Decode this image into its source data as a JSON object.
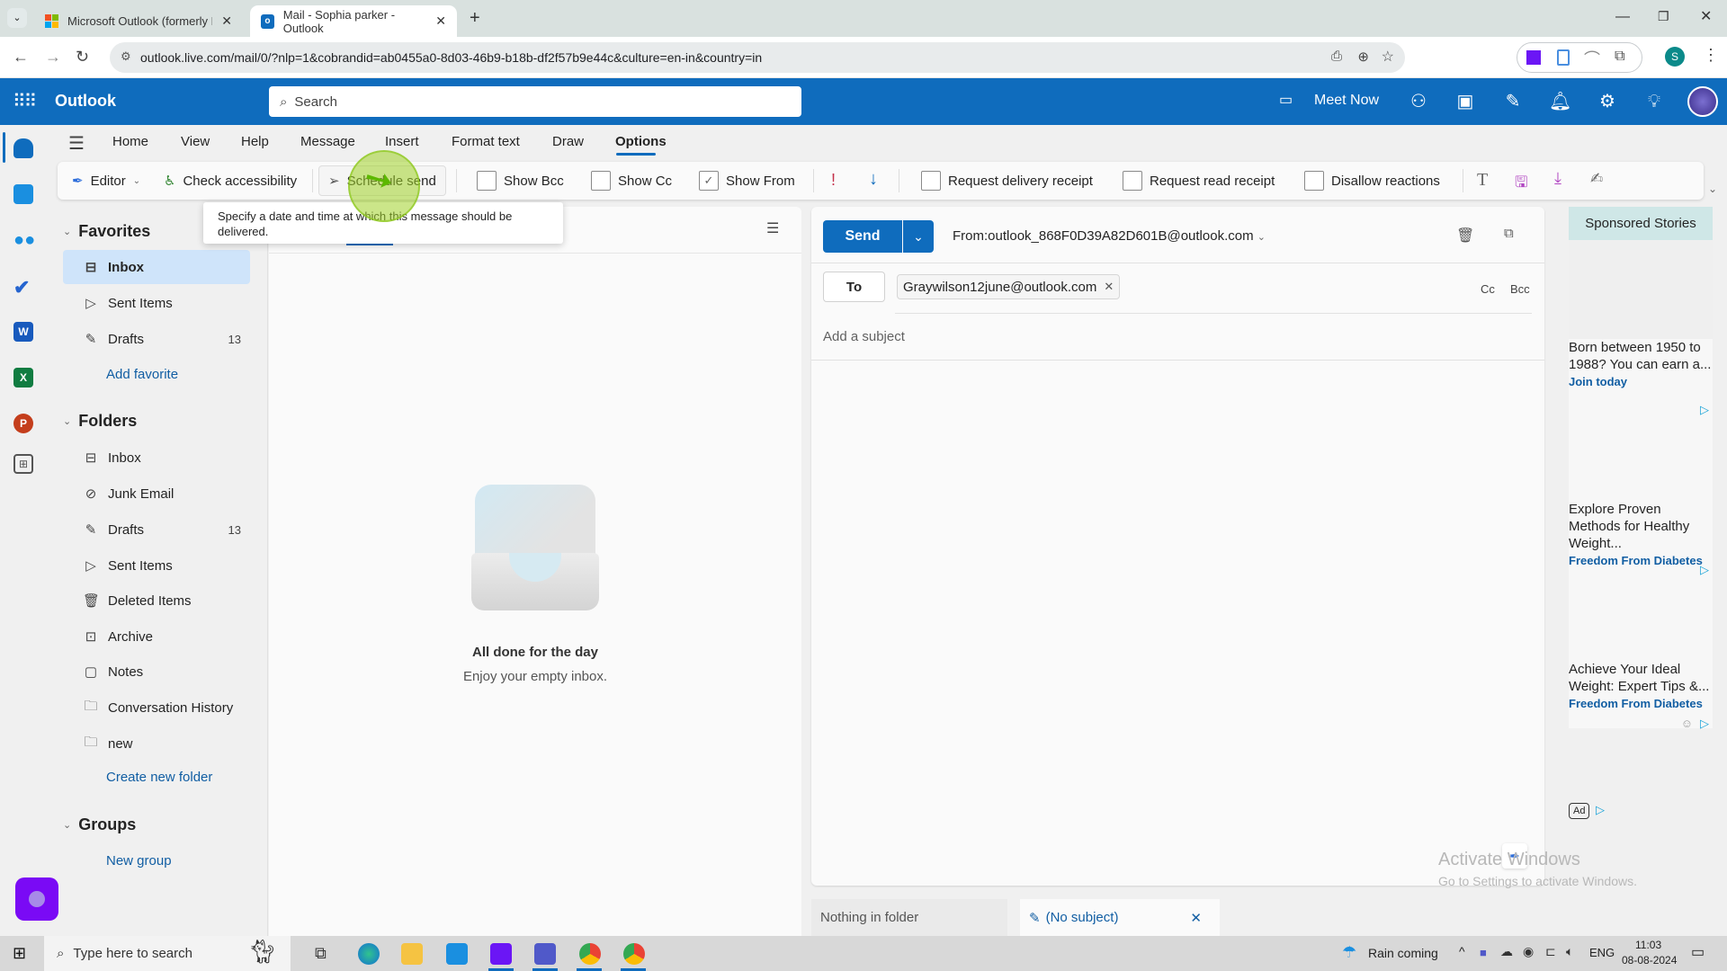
{
  "browser": {
    "tabs": [
      {
        "title": "Microsoft Outlook (formerly Ho",
        "active": false
      },
      {
        "title": "Mail - Sophia parker - Outlook",
        "active": true
      }
    ],
    "url": "outlook.live.com/mail/0/?nlp=1&cobrandid=ab0455a0-8d03-46b9-b18b-df2f57b9e44c&culture=en-in&country=in",
    "profile_initial": "S"
  },
  "app": {
    "name": "Outlook",
    "search_placeholder": "Search",
    "meet_now": "Meet Now"
  },
  "ribbon_tabs": [
    "Home",
    "View",
    "Help",
    "Message",
    "Insert",
    "Format text",
    "Draw",
    "Options"
  ],
  "active_ribbon_tab": "Options",
  "ribbon": {
    "editor": "Editor",
    "check_accessibility": "Check accessibility",
    "schedule_send": "Schedule send",
    "show_bcc": {
      "label": "Show Bcc",
      "checked": false
    },
    "show_cc": {
      "label": "Show Cc",
      "checked": false
    },
    "show_from": {
      "label": "Show From",
      "checked": true
    },
    "request_delivery_receipt": {
      "label": "Request delivery receipt",
      "checked": false
    },
    "request_read_receipt": {
      "label": "Request read receipt",
      "checked": false
    },
    "disallow_reactions": {
      "label": "Disallow reactions",
      "checked": false
    }
  },
  "tooltip": "Specify a date and time at which this message should be delivered.",
  "favorites": {
    "title": "Favorites",
    "items": [
      {
        "label": "Inbox",
        "icon": "inbox",
        "count": "",
        "selected": true
      },
      {
        "label": "Sent Items",
        "icon": "send",
        "count": ""
      },
      {
        "label": "Drafts",
        "icon": "pencil",
        "count": "13"
      }
    ],
    "add_link": "Add favorite"
  },
  "folders": {
    "title": "Folders",
    "items": [
      {
        "label": "Inbox",
        "icon": "inbox",
        "count": ""
      },
      {
        "label": "Junk Email",
        "icon": "junk",
        "count": ""
      },
      {
        "label": "Drafts",
        "icon": "pencil",
        "count": "13"
      },
      {
        "label": "Sent Items",
        "icon": "send",
        "count": ""
      },
      {
        "label": "Deleted Items",
        "icon": "trash",
        "count": ""
      },
      {
        "label": "Archive",
        "icon": "archive",
        "count": ""
      },
      {
        "label": "Notes",
        "icon": "note",
        "count": ""
      },
      {
        "label": "Conversation History",
        "icon": "folder",
        "count": ""
      },
      {
        "label": "new",
        "icon": "folder",
        "count": ""
      }
    ],
    "create_link": "Create new folder"
  },
  "groups": {
    "title": "Groups",
    "new_link": "New group"
  },
  "message_list": {
    "empty_title": "All done for the day",
    "empty_subtitle": "Enjoy your empty inbox."
  },
  "compose": {
    "send": "Send",
    "from": "From:outlook_868F0D39A82D601B@outlook.com",
    "to_label": "To",
    "recipient": "Graywilson12june@outlook.com",
    "cc": "Cc",
    "bcc": "Bcc",
    "subject_placeholder": "Add a subject"
  },
  "ads": {
    "header": "Sponsored Stories",
    "items": [
      {
        "text": "Born between 1950 to 1988? You can earn a...",
        "source": "Join today"
      },
      {
        "text": "Explore Proven Methods for Healthy Weight...",
        "source": "Freedom From Diabetes"
      },
      {
        "text": "Achieve Your Ideal Weight: Expert Tips &...",
        "source": "Freedom From Diabetes"
      }
    ],
    "ad_badge": "Ad"
  },
  "bottom_tabs": {
    "nothing": "Nothing in folder",
    "draft": "(No subject)"
  },
  "watermark": {
    "line1": "Activate Windows",
    "line2": "Go to Settings to activate Windows."
  },
  "taskbar": {
    "search_placeholder": "Type here to search",
    "weather": "Rain coming",
    "language": "ENG",
    "time": "11:03",
    "date": "08-08-2024"
  },
  "colors": {
    "brand": "#0f6cbd",
    "selected": "#cfe4fa",
    "link": "#115ea3"
  }
}
